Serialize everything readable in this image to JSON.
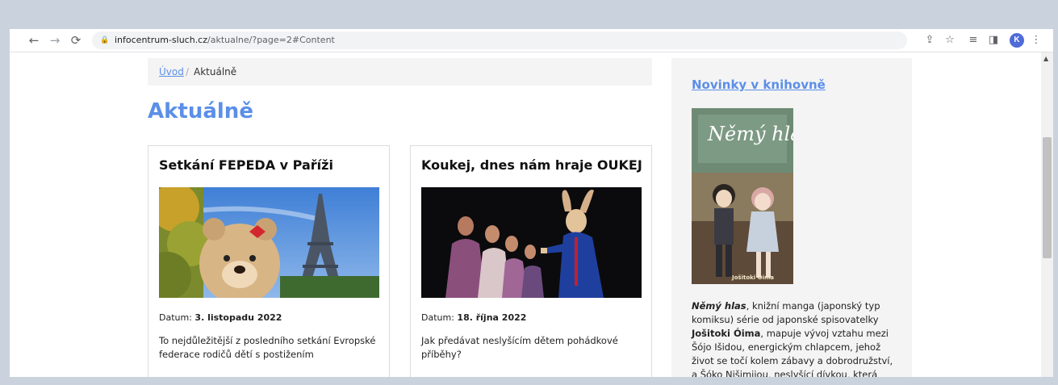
{
  "browser": {
    "url_domain": "infocentrum-sluch.cz",
    "url_path": "/aktualne/?page=2#Content",
    "avatar_letter": "K",
    "icons": [
      "back-arrow-icon",
      "forward-arrow-icon",
      "reload-icon",
      "lock-icon",
      "share-icon",
      "star-icon",
      "reading-list-icon",
      "side-panel-icon",
      "kebab-menu-icon"
    ]
  },
  "breadcrumb": {
    "home": "Úvod",
    "separator": "/",
    "current": "Aktuálně"
  },
  "page": {
    "title": "Aktuálně"
  },
  "articles": [
    {
      "title": "Setkání FEPEDA v Paříži",
      "date_label": "Datum:",
      "date": "3. listopadu 2022",
      "excerpt": "To nejdůležitější z posledního setkání Evropské federace rodičů dětí s postižením"
    },
    {
      "title": "Koukej, dnes nám hraje OUKEJ",
      "date_label": "Datum:",
      "date": "18. října 2022",
      "excerpt": "Jak předávat neslyšícím dětem pohádkové příběhy?"
    }
  ],
  "sidebar": {
    "title": "Novinky v knihovně",
    "book_cover_title": "Němý hlas",
    "book_cover_author": "Jošitoki Óima",
    "text_parts": {
      "book_title": "Němý hlas",
      "part1": ", knižní manga (japonský typ komiksu) série od japonské spisovatelky ",
      "author": "Jošitoki Óima",
      "part2": ", mapuje vývoj vztahu mezi Šójo Išidou, energickým chlapcem, jehož život se točí kolem zábavy a dobrodružství, a Šóko Nišimijou, neslyšící dívkou, která přestoupila"
    }
  },
  "colors": {
    "accent": "#5b8fe8",
    "page_background": "#cad3dd"
  }
}
